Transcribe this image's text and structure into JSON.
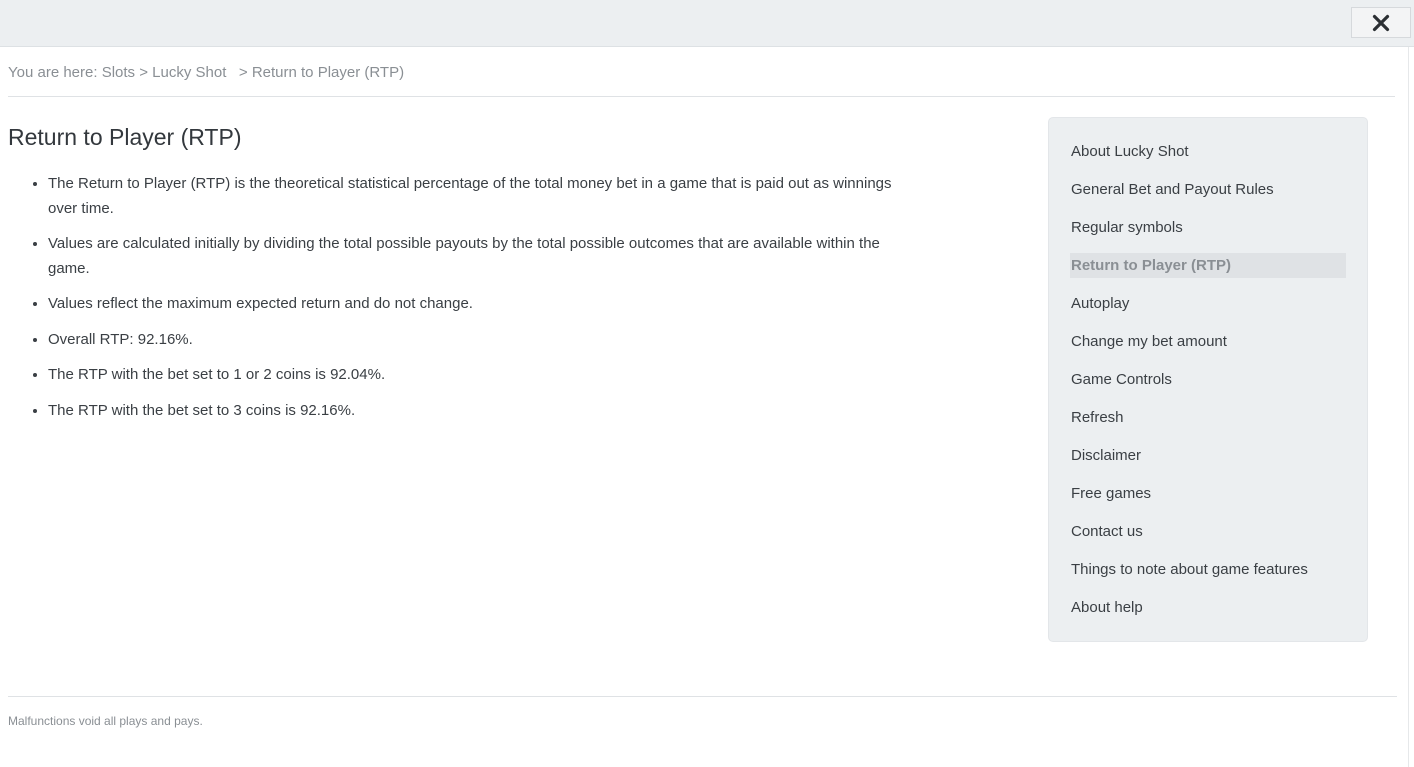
{
  "header": {
    "close_icon": "close-x-icon"
  },
  "breadcrumb": {
    "prefix": "You are here: ",
    "items": [
      "Slots",
      "Lucky Shot",
      "Return to Player (RTP)"
    ],
    "separator": ">"
  },
  "main": {
    "title": "Return to Player (RTP)",
    "bullets": [
      "The Return to Player (RTP) is the theoretical statistical percentage of the total money bet in a game that is paid out as winnings over time.",
      "Values are calculated initially by dividing the total possible payouts by the total possible outcomes that are available within the game.",
      "Values reflect the maximum expected return and do not change.",
      "Overall RTP: 92.16%.",
      "The RTP with the bet set to 1 or 2 coins is 92.04%.",
      "The RTP with the bet set to 3 coins is 92.16%."
    ]
  },
  "sidebar": {
    "active_index": 3,
    "items": [
      "About Lucky Shot",
      "General Bet and Payout Rules",
      "Regular symbols",
      "Return to Player (RTP)",
      "Autoplay",
      "Change my bet amount",
      "Game Controls",
      "Refresh",
      "Disclaimer",
      "Free games",
      "Contact us",
      "Things to note about game features",
      "About help"
    ]
  },
  "footer": {
    "note": "Malfunctions void all plays and pays."
  },
  "colors": {
    "topbar_bg": "#eceff1",
    "sidebar_bg": "#eceff1",
    "active_item_bg": "#dfe2e5",
    "text": "#3a3f44",
    "muted_text": "#8a8f94"
  }
}
